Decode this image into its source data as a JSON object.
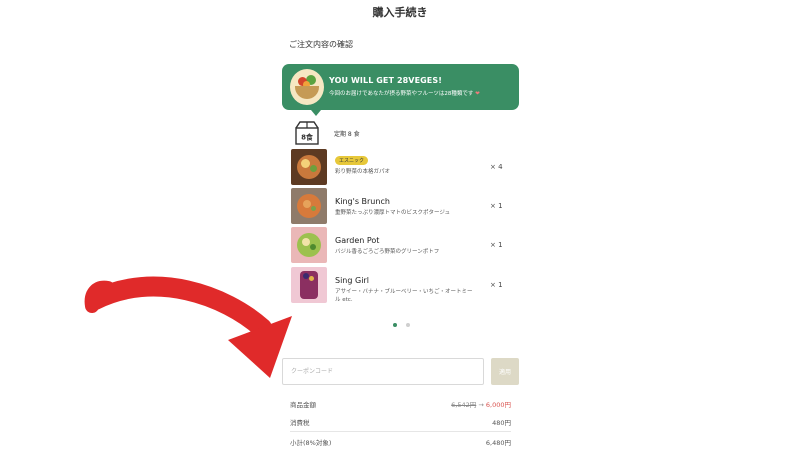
{
  "header": {
    "title": "購入手続き"
  },
  "order": {
    "section_title": "ご注文内容の確認",
    "banner": {
      "headline": "YOU WILL GET 28VEGES!",
      "subtext": "今回のお届けであなたが摂る野菜やフルーツは28種類です",
      "heart": "❤",
      "icon": "vegetable-basket"
    },
    "plan": {
      "badge": "8食",
      "label": "定期 8 食"
    },
    "items": [
      {
        "tag": "エスニック",
        "name": "",
        "desc": "彩り野菜の本格ガパオ",
        "qty": "× 4"
      },
      {
        "tag": "",
        "name": "King's Brunch",
        "desc": "重野菜たっぷり濃厚トマトのビスクポタージュ",
        "qty": "× 1"
      },
      {
        "tag": "",
        "name": "Garden Pot",
        "desc": "バジル香るごろごろ野菜のグリーンポトフ",
        "qty": "× 1"
      },
      {
        "tag": "",
        "name": "Sing Girl",
        "desc": "アサイー・バナナ・ブルーベリー・いちご・オートミール etc.",
        "qty": "× 1"
      }
    ],
    "carousel": {
      "active_index": 0,
      "count": 2
    }
  },
  "coupon": {
    "placeholder": "クーポンコード",
    "apply_label": "適用"
  },
  "summary": {
    "rows": [
      {
        "label": "商品金額",
        "old_value": "6,542円",
        "value": "6,000円"
      },
      {
        "label": "消費税",
        "value": "480円"
      },
      {
        "label": "小計(8%対象)",
        "value": "6,480円"
      }
    ]
  },
  "colors": {
    "brand_green": "#3a8e64",
    "tag_yellow": "#e7c83a",
    "price_red": "#d9534f",
    "arrow_red": "#e02a2a",
    "apply_disabled": "#ddd9c6"
  }
}
